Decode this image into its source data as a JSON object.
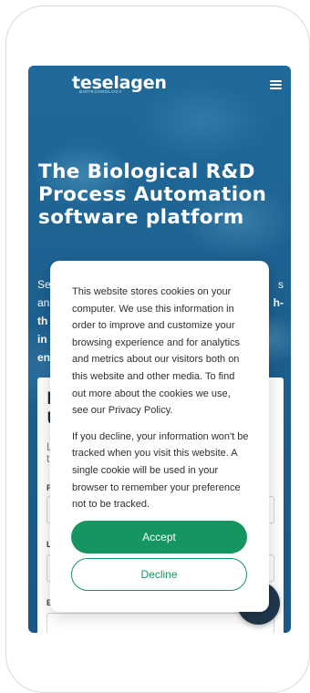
{
  "header": {
    "logo_text": "teselagen",
    "logo_subtext": "BIOTECHNOLOGY",
    "menu_icon": "hamburger-menu-icon"
  },
  "hero": {
    "title": "The Biological R&D Process Automation software platform",
    "text_line1_start": "Se",
    "text_line1_end": "s",
    "text_line2_start": "an",
    "text_line2_end": "h-",
    "text_line3": "th",
    "text_line4": "in",
    "text_line5": "en"
  },
  "form": {
    "heading_line1": "L",
    "heading_line2": "U",
    "sub_line1": "L",
    "sub_line2": "t",
    "label_first": "F",
    "label_last": "L",
    "label_email": "E"
  },
  "cookie_banner": {
    "paragraph1": "This website stores cookies on your computer. We use this information in order to improve and customize your browsing experience and for analytics and metrics about our visitors both on this website and other media. To find out more about the cookies we use, see our Privacy Policy.",
    "paragraph2": "If you decline, your information won't be tracked when you visit this website. A single cookie will be used in your browser to remember your preference not to be tracked.",
    "accept_label": "Accept",
    "decline_label": "Decline"
  },
  "colors": {
    "accent_green": "#15955f",
    "hero_blue": "#1c5f8e",
    "chat_bubble": "#20364a"
  }
}
